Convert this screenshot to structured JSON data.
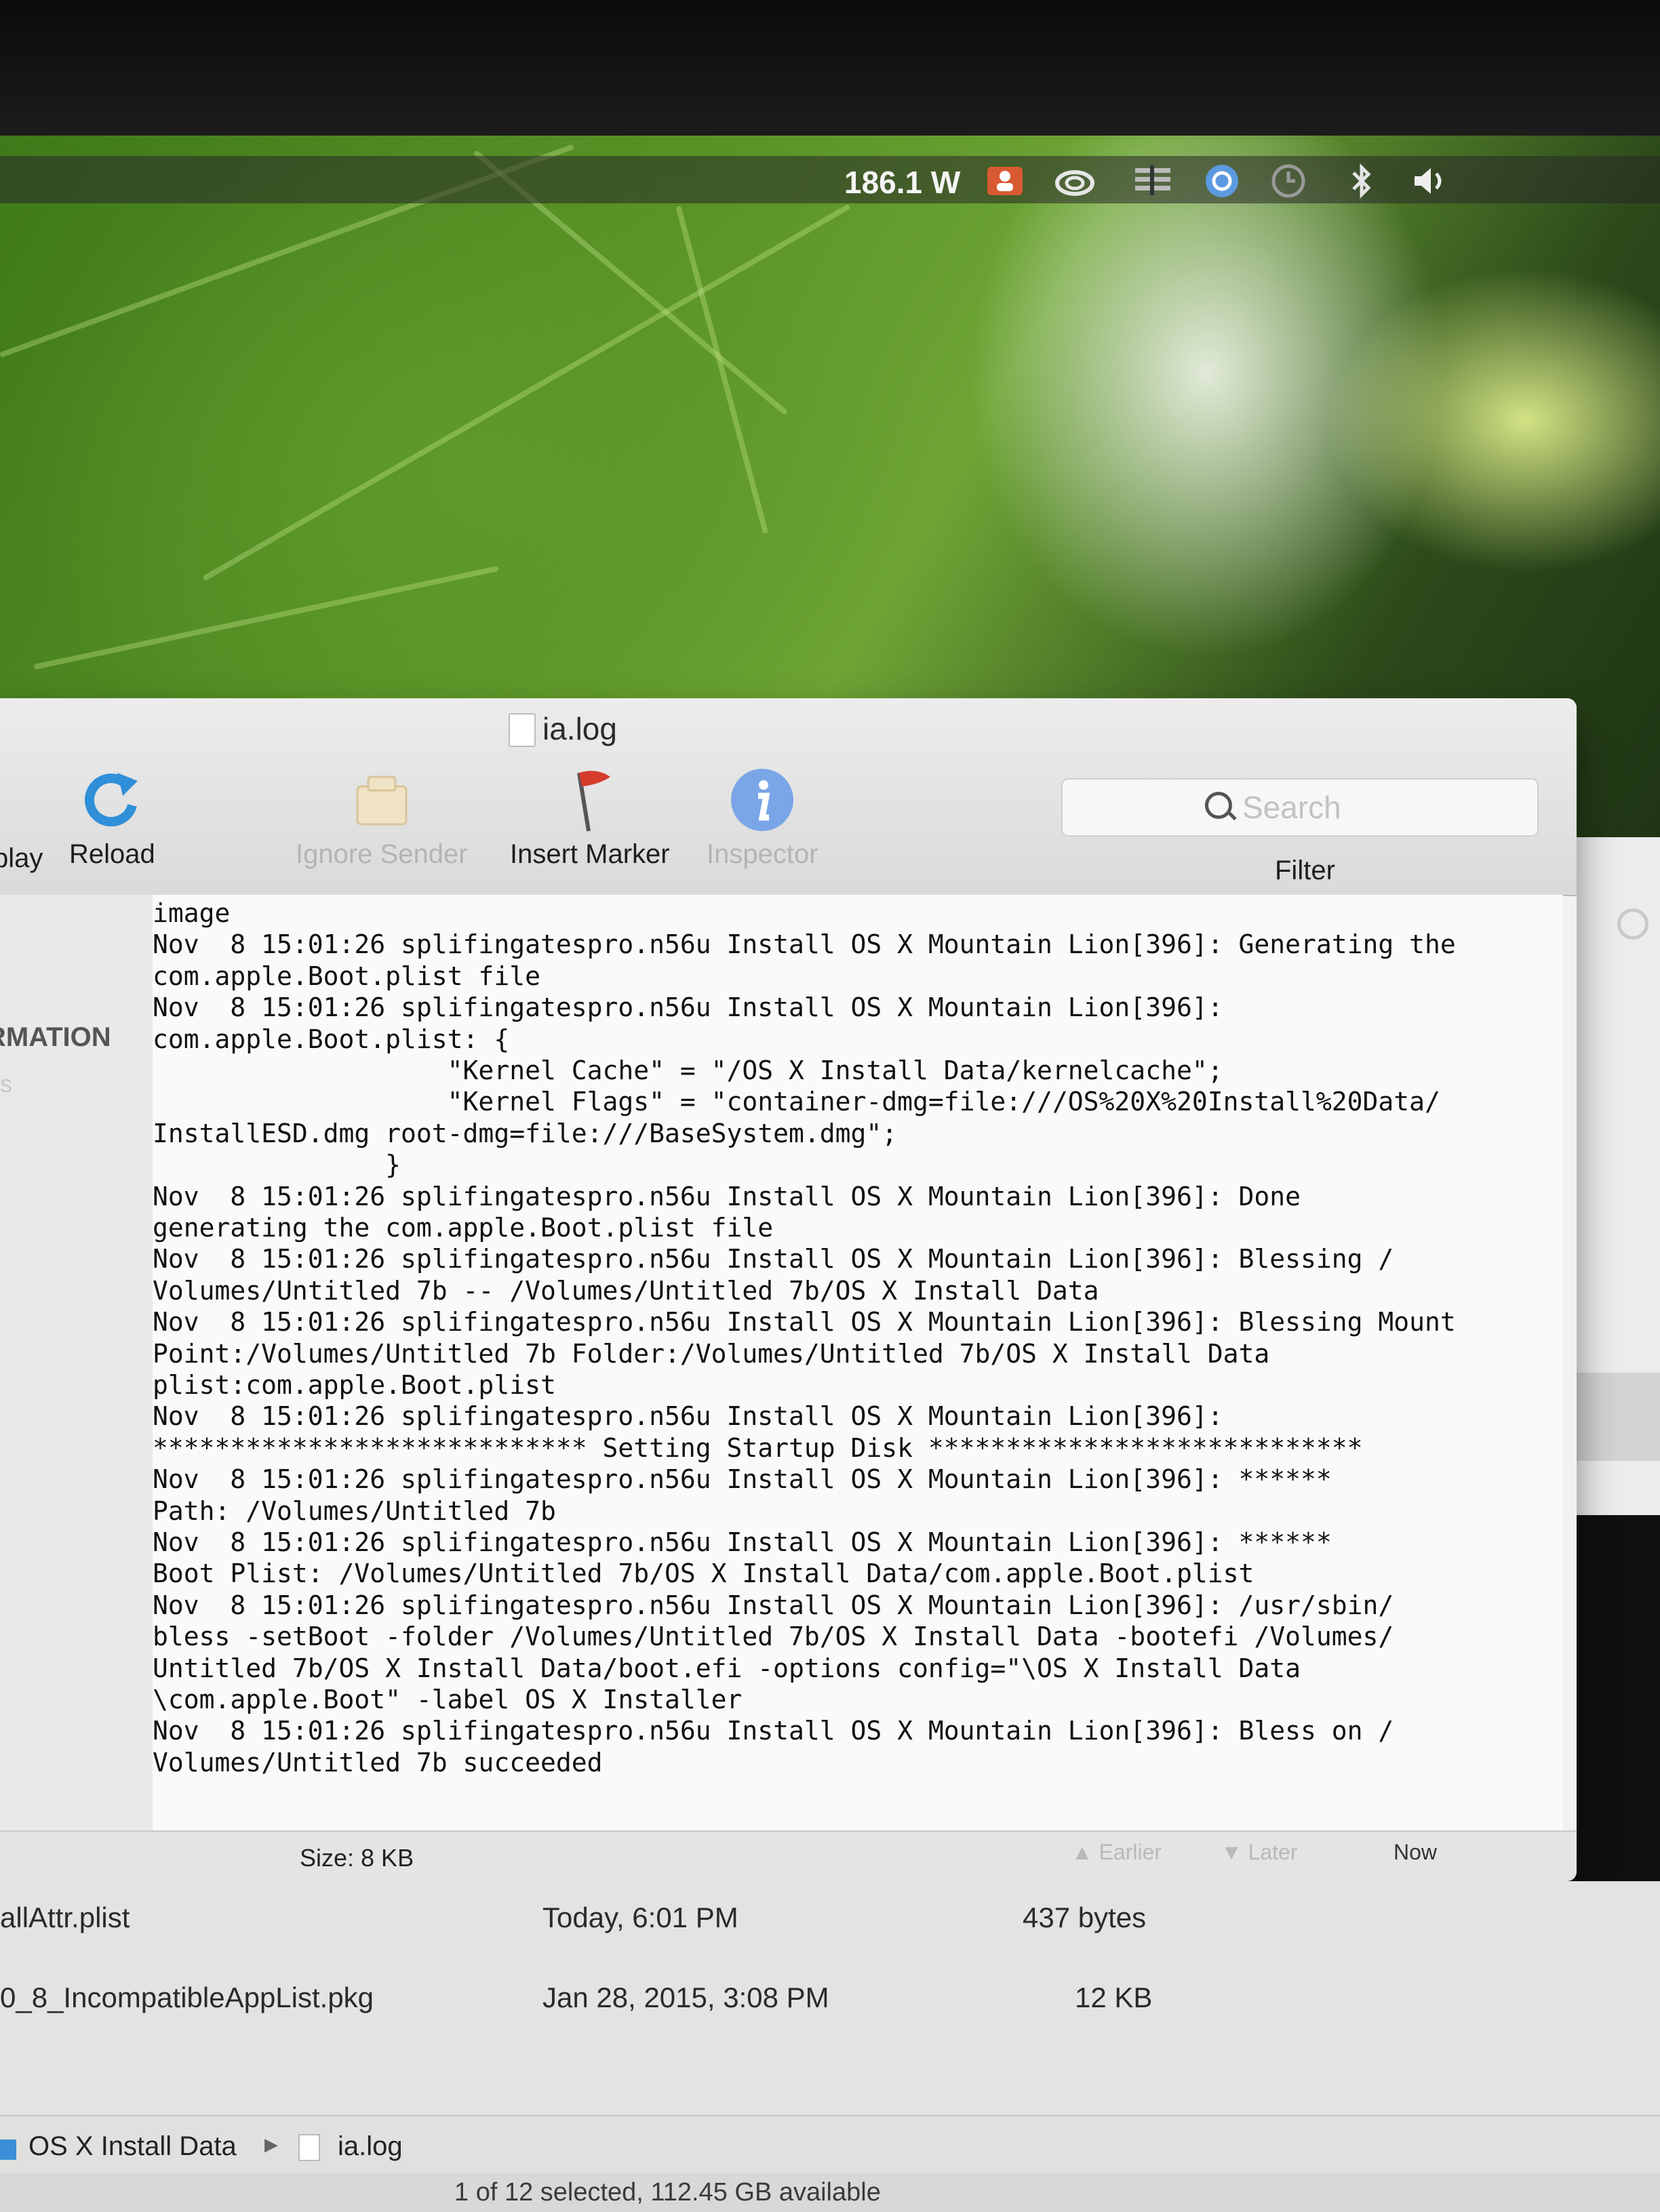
{
  "menubar": {
    "power_reading": "186.1 W",
    "icons": [
      "user-icon",
      "creative-cloud-icon",
      "menu-extra-icon",
      "sync-icon",
      "time-machine-icon",
      "bluetooth-icon",
      "volume-icon"
    ]
  },
  "console_window": {
    "title": "ia.log",
    "toolbar": {
      "display_partial": "play",
      "reload": "Reload",
      "ignore_sender": "Ignore Sender",
      "insert_marker": "Insert Marker",
      "inspector": "Inspector",
      "search_placeholder": "Search",
      "filter": "Filter"
    },
    "sidebar": {
      "section_partial": "RMATION",
      "sub_partial": "es"
    },
    "log_lines": [
      "image",
      "Nov  8 15:01:26 splifingatespro.n56u Install OS X Mountain Lion[396]: Generating the",
      "com.apple.Boot.plist file",
      "Nov  8 15:01:26 splifingatespro.n56u Install OS X Mountain Lion[396]:",
      "com.apple.Boot.plist: {",
      "                   \"Kernel Cache\" = \"/OS X Install Data/kernelcache\";",
      "                   \"Kernel Flags\" = \"container-dmg=file:///OS%20X%20Install%20Data/",
      "InstallESD.dmg root-dmg=file:///BaseSystem.dmg\";",
      "               }",
      "Nov  8 15:01:26 splifingatespro.n56u Install OS X Mountain Lion[396]: Done",
      "generating the com.apple.Boot.plist file",
      "Nov  8 15:01:26 splifingatespro.n56u Install OS X Mountain Lion[396]: Blessing /",
      "Volumes/Untitled 7b -- /Volumes/Untitled 7b/OS X Install Data",
      "Nov  8 15:01:26 splifingatespro.n56u Install OS X Mountain Lion[396]: Blessing Mount",
      "Point:/Volumes/Untitled 7b Folder:/Volumes/Untitled 7b/OS X Install Data",
      "plist:com.apple.Boot.plist",
      "Nov  8 15:01:26 splifingatespro.n56u Install OS X Mountain Lion[396]:",
      "**************************** Setting Startup Disk ****************************",
      "Nov  8 15:01:26 splifingatespro.n56u Install OS X Mountain Lion[396]: ******",
      "Path: /Volumes/Untitled 7b",
      "Nov  8 15:01:26 splifingatespro.n56u Install OS X Mountain Lion[396]: ******",
      "Boot Plist: /Volumes/Untitled 7b/OS X Install Data/com.apple.Boot.plist",
      "Nov  8 15:01:26 splifingatespro.n56u Install OS X Mountain Lion[396]: /usr/sbin/",
      "bless -setBoot -folder /Volumes/Untitled 7b/OS X Install Data -bootefi /Volumes/",
      "Untitled 7b/OS X Install Data/boot.efi -options config=\"\\OS X Install Data",
      "\\com.apple.Boot\" -label OS X Installer",
      "Nov  8 15:01:26 splifingatespro.n56u Install OS X Mountain Lion[396]: Bless on /",
      "Volumes/Untitled 7b succeeded"
    ],
    "status": {
      "size": "Size: 8 KB",
      "earlier": "Earlier",
      "later": "Later",
      "now": "Now"
    }
  },
  "finder": {
    "files": [
      {
        "name": "allAttr.plist",
        "date": "Today, 6:01 PM",
        "size": "437 bytes"
      },
      {
        "name": "0_8_IncompatibleAppList.pkg",
        "date": "Jan 28, 2015, 3:08 PM",
        "size": "12 KB"
      }
    ],
    "path": [
      "OS X Install Data",
      "ia.log"
    ],
    "status": "1 of 12 selected, 112.45 GB available"
  }
}
